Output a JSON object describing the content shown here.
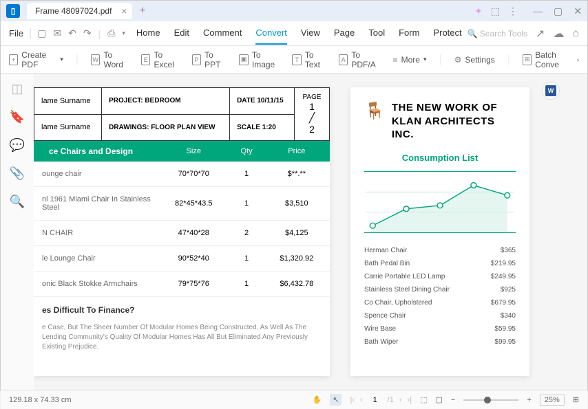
{
  "titlebar": {
    "tab_name": "Frame 48097024.pdf"
  },
  "menubar": {
    "file": "File",
    "tabs": [
      "Home",
      "Edit",
      "Comment",
      "Convert",
      "View",
      "Page",
      "Tool",
      "Form",
      "Protect"
    ],
    "active_tab": 3,
    "search_placeholder": "Search Tools"
  },
  "toolbar": {
    "items": [
      "Create PDF",
      "To Word",
      "To Excel",
      "To PPT",
      "To Image",
      "To Text",
      "To PDF/A",
      "More",
      "Settings",
      "Batch Conve"
    ]
  },
  "document": {
    "project_header": {
      "col1_r1": "lame Surname",
      "col1_r2": "lame Surname",
      "col2_r1": "PROJECT: BEDROOM",
      "col2_r2": "DRAWINGS: FLOOR PLAN VIEW",
      "col3_r1": "DATE 10/11/15",
      "col3_r2": "SCALE 1:20",
      "col4_label": "PAGE",
      "col4_value": "1 / 2"
    },
    "chairs": {
      "header": "ce Chairs and Design",
      "columns": [
        "Size",
        "Qty",
        "Price"
      ],
      "rows": [
        {
          "name": "ounge chair",
          "size": "70*70*70",
          "qty": "1",
          "price": "$**.**"
        },
        {
          "name": "nl 1961 Miami Chair In Stainless Steel",
          "size": "82*45*43.5",
          "qty": "1",
          "price": "$3,510"
        },
        {
          "name": "N CHAIR",
          "size": "47*40*28",
          "qty": "2",
          "price": "$4,125"
        },
        {
          "name": "le Lounge Chair",
          "size": "90*52*40",
          "qty": "1",
          "price": "$1,320.92"
        },
        {
          "name": "onic Black Stokke Armchairs",
          "size": "79*75*76",
          "qty": "1",
          "price": "$6,432.78"
        }
      ]
    },
    "finance": {
      "title": "es Difficult To Finance?",
      "body": "e Case, But The Sheer Number Of Modular Homes Being Constructed, As Well As The Lending Community's Quality Of Modular Homes Has All But Eliminated Any Previously Existing Prejudice."
    },
    "arch": {
      "title_l1": "THE NEW WORK OF",
      "title_l2": "KLAN ARCHITECTS INC.",
      "subtitle": "Consumption List",
      "prices": [
        {
          "name": "Herman Chair",
          "price": "$365"
        },
        {
          "name": "Bath Pedal Bin",
          "price": "$219.95"
        },
        {
          "name": "Carrie Portable LED Lamp",
          "price": "$249.95"
        },
        {
          "name": "Stainless Steel Dining Chair",
          "price": "$925"
        },
        {
          "name": "Co Chair, Upholstered",
          "price": "$679.95"
        },
        {
          "name": "Spence Chair",
          "price": "$340"
        },
        {
          "name": "Wire Base",
          "price": "$59.95"
        },
        {
          "name": "Bath Wiper",
          "price": "$99.95"
        }
      ]
    }
  },
  "chart_data": {
    "type": "line",
    "x": [
      1,
      2,
      3,
      4,
      5
    ],
    "values": [
      10,
      35,
      40,
      70,
      55
    ],
    "ylim": [
      0,
      100
    ]
  },
  "statusbar": {
    "dimensions": "129.18 x 74.33 cm",
    "page": "1",
    "pages": "/1",
    "zoom": "25%"
  }
}
